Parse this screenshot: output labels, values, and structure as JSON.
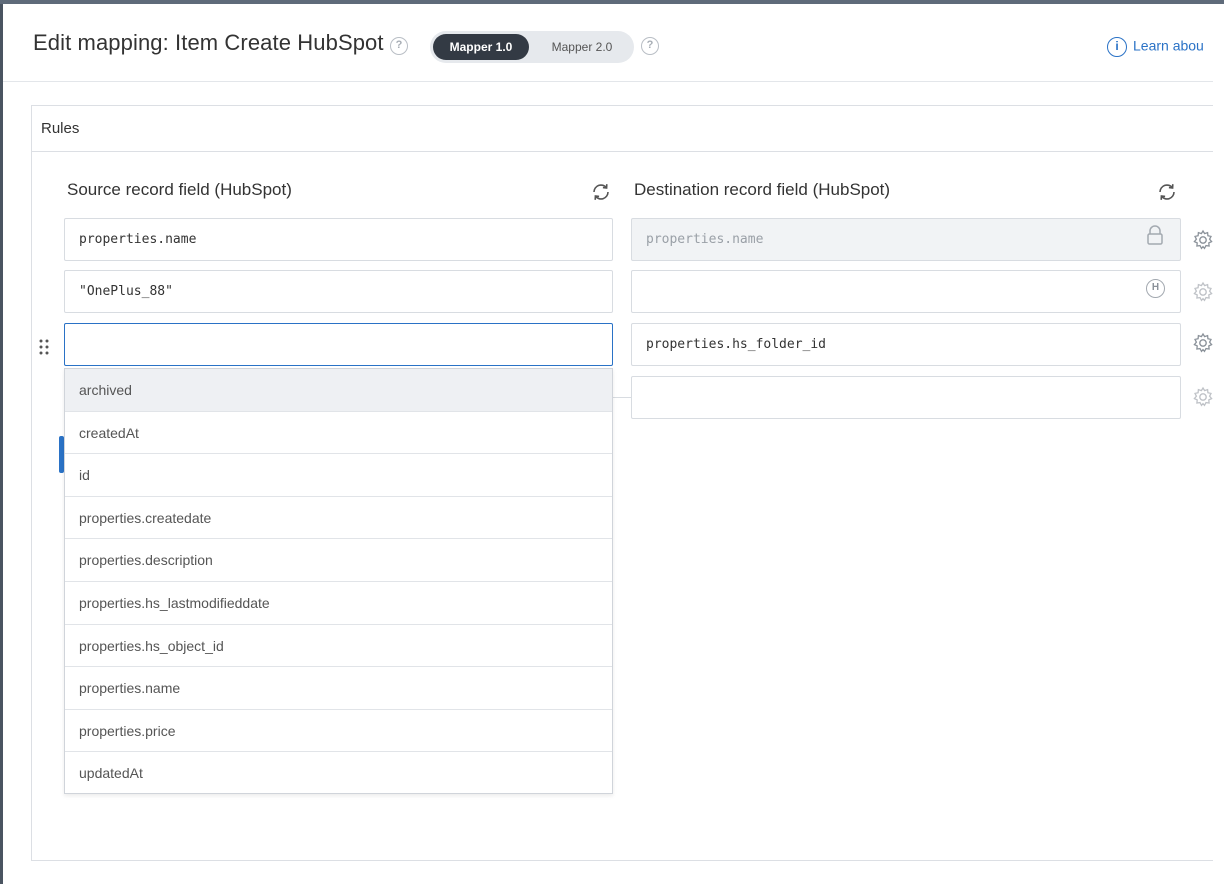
{
  "header": {
    "title": "Edit mapping: Item Create HubSpot",
    "help_symbol": "?",
    "toggle": {
      "active": "Mapper 1.0",
      "inactive": "Mapper 2.0"
    },
    "learn_link": "Learn abou",
    "learn_icon_symbol": "i"
  },
  "panel": {
    "title": "Rules",
    "source_heading": "Source record field (HubSpot)",
    "destination_heading": "Destination record field (HubSpot)"
  },
  "rows": [
    {
      "source": "properties.name",
      "destination": "properties.name",
      "destination_icon": "lock-icon"
    },
    {
      "source": "\"OnePlus_88\"",
      "destination": "",
      "destination_icon": "hardcoded-h-icon",
      "destination_icon_text": "H"
    },
    {
      "source": "",
      "destination": "properties.hs_folder_id"
    },
    {
      "source": "",
      "destination": ""
    }
  ],
  "dropdown": {
    "options": [
      "archived",
      "createdAt",
      "id",
      "properties.createdate",
      "properties.description",
      "properties.hs_lastmodifieddate",
      "properties.hs_object_id",
      "properties.name",
      "properties.price",
      "updatedAt"
    ],
    "highlighted": "archived"
  },
  "colors": {
    "accent": "#2a72c6",
    "toggle_active_bg": "#333a44",
    "border": "#d8dce1",
    "locked_bg": "#f1f3f5"
  }
}
